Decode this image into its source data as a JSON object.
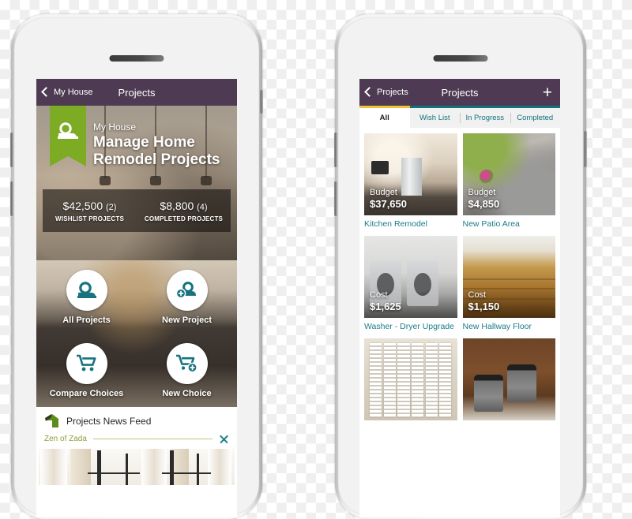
{
  "left_phone": {
    "navbar": {
      "back_label": "My House",
      "title": "Projects",
      "back_icon": "chevron-left-icon"
    },
    "hero": {
      "kicker": "My House",
      "headline_line1": "Manage Home",
      "headline_line2": "Remodel Projects",
      "ribbon_icon": "tape-measure-icon"
    },
    "stats": [
      {
        "value": "$42,500",
        "count": "(2)",
        "label": "WISHLIST PROJECTS"
      },
      {
        "value": "$8,800",
        "count": "(4)",
        "label": "COMPLETED PROJECTS"
      }
    ],
    "actions": [
      {
        "label": "All Projects",
        "icon": "tape-measure-icon"
      },
      {
        "label": "New Project",
        "icon": "tape-measure-plus-icon"
      },
      {
        "label": "Compare Choices",
        "icon": "shopping-cart-icon"
      },
      {
        "label": "New Choice",
        "icon": "shopping-cart-plus-icon"
      }
    ],
    "news_feed": {
      "title": "Projects News Feed",
      "icon": "green-house-icon",
      "item_label": "Zen of Zada",
      "close_icon": "close-x-icon"
    }
  },
  "right_phone": {
    "navbar": {
      "back_label": "Projects",
      "title": "Projects",
      "back_icon": "chevron-left-icon",
      "add_icon": "plus-icon"
    },
    "tabs": [
      {
        "label": "All",
        "active": true
      },
      {
        "label": "Wish List",
        "active": false
      },
      {
        "label": "In Progress",
        "active": false
      },
      {
        "label": "Completed",
        "active": false
      }
    ],
    "projects": [
      {
        "title": "Kitchen Remodel",
        "caption_key": "Budget",
        "caption_value": "$37,650",
        "thumb": "kitchen-thumbnail"
      },
      {
        "title": "New Patio Area",
        "caption_key": "Budget",
        "caption_value": "$4,850",
        "thumb": "patio-thumbnail"
      },
      {
        "title": "Washer - Dryer Upgrade",
        "caption_key": "Cost",
        "caption_value": "$1,625",
        "thumb": "laundry-thumbnail"
      },
      {
        "title": "New Hallway Floor",
        "caption_key": "Cost",
        "caption_value": "$1,150",
        "thumb": "hardwood-floor-thumbnail"
      },
      {
        "title": "",
        "caption_key": "",
        "caption_value": "",
        "thumb": "window-shutters-thumbnail"
      },
      {
        "title": "",
        "caption_key": "",
        "caption_value": "",
        "thumb": "trash-bins-thumbnail"
      }
    ]
  },
  "colors": {
    "header_purple": "#4e3b53",
    "accent_teal": "#12737d",
    "ribbon_green": "#7eab24",
    "tab_active_gold": "#efc133",
    "feed_olive": "#8aa23a"
  }
}
